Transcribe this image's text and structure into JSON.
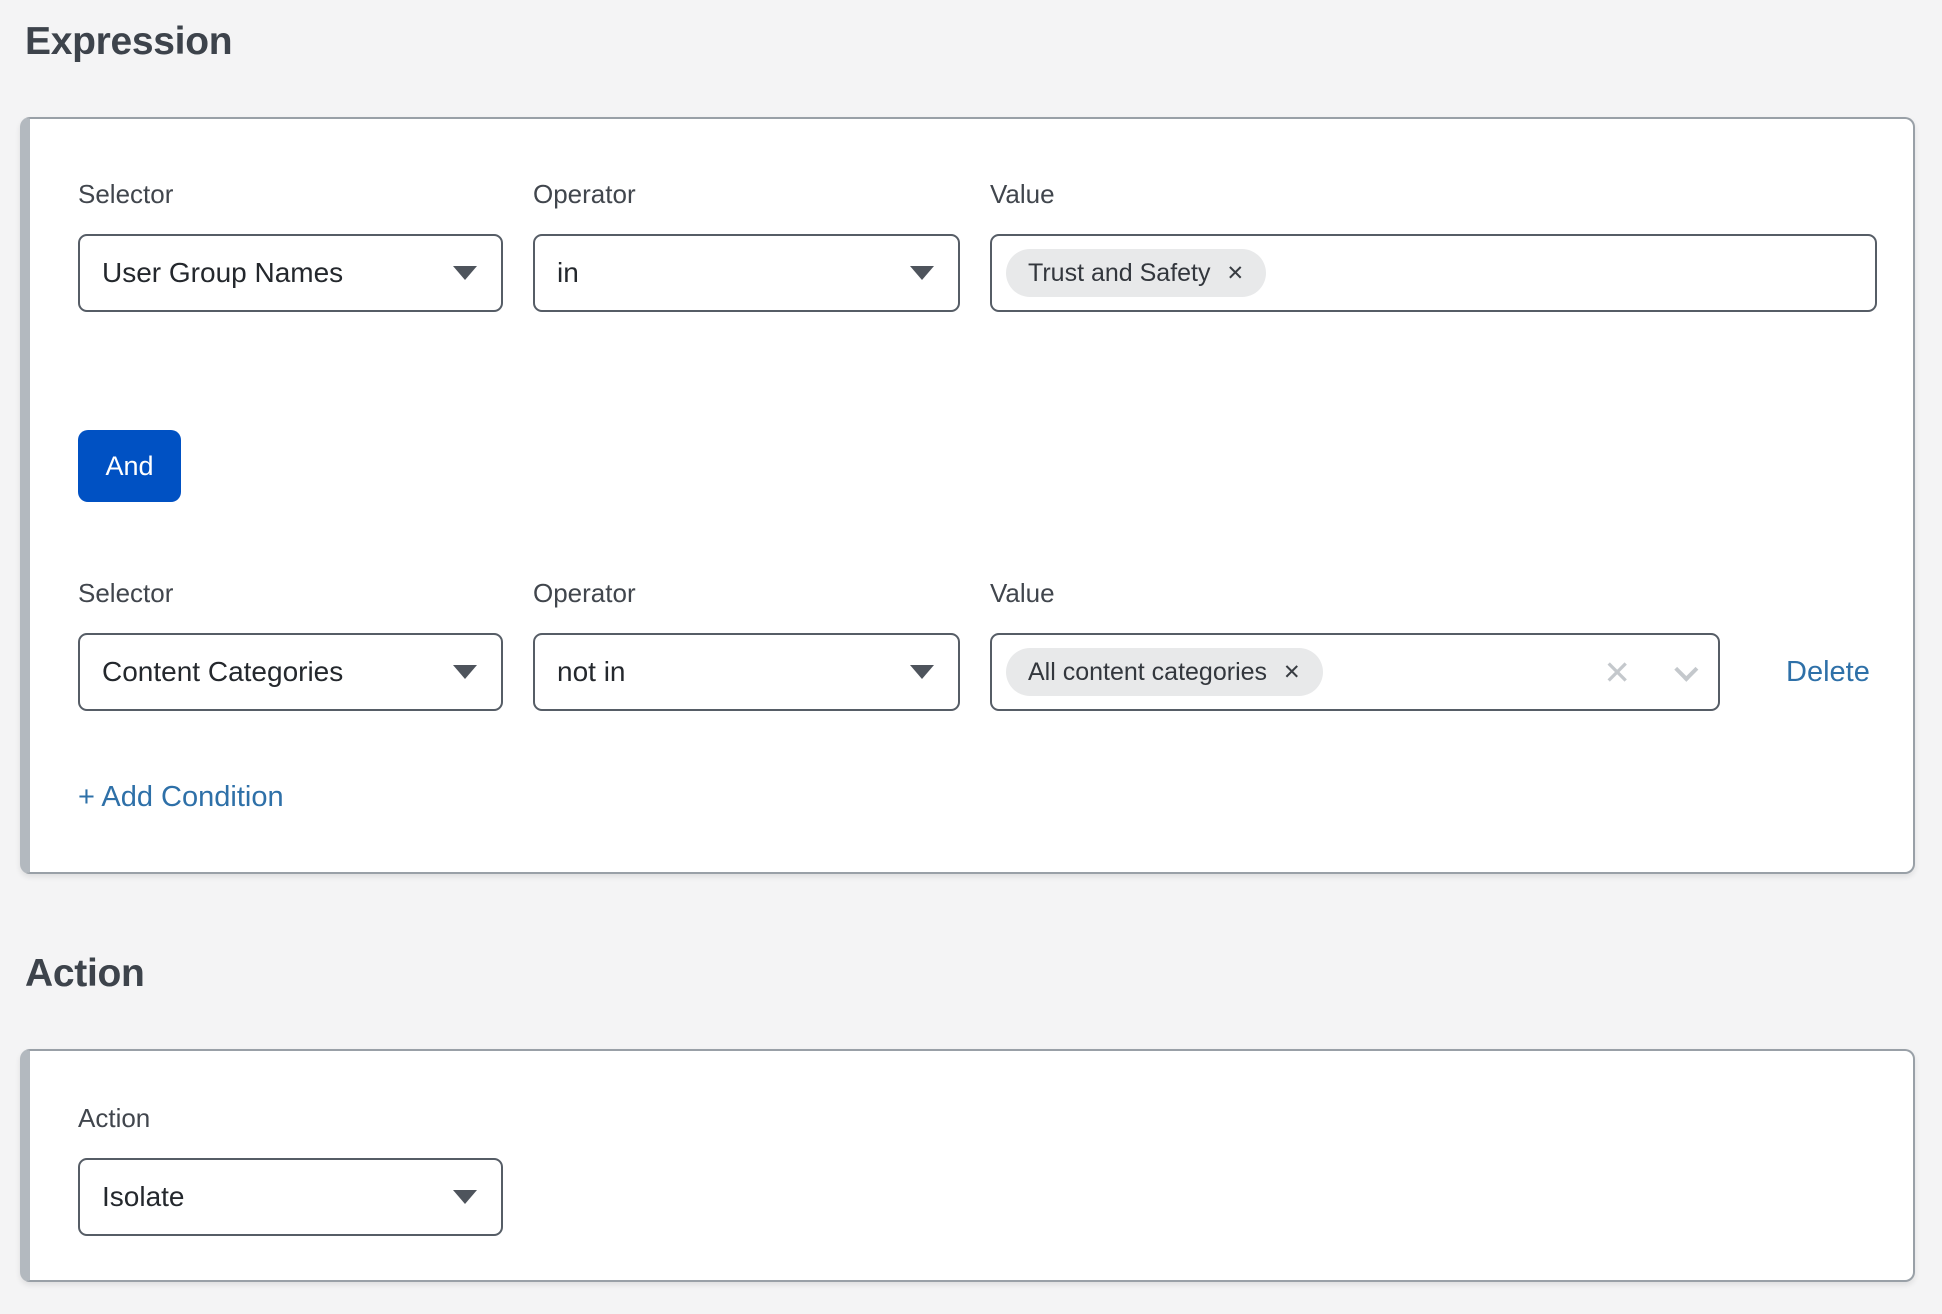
{
  "headings": {
    "expression": "Expression",
    "action": "Action"
  },
  "expression_card": {
    "and_button": "And",
    "add_condition": "+ Add Condition",
    "conditions": [
      {
        "labels": {
          "selector": "Selector",
          "operator": "Operator",
          "value": "Value"
        },
        "selector": "User Group Names",
        "operator": "in",
        "tags": [
          "Trust and Safety"
        ]
      },
      {
        "labels": {
          "selector": "Selector",
          "operator": "Operator",
          "value": "Value"
        },
        "selector": "Content Categories",
        "operator": "not in",
        "tags": [
          "All content categories"
        ],
        "delete_link": "Delete"
      }
    ]
  },
  "action_card": {
    "label": "Action",
    "value": "Isolate"
  },
  "icons": {
    "tag_remove": "✕",
    "clear": "✕"
  },
  "colors": {
    "primary_blue": "#0051c3",
    "link_blue": "#2e70a8",
    "page_bg": "#f4f4f5",
    "field_border": "#565d66",
    "card_border": "#99a0a7",
    "card_accent": "#b3b9bf",
    "tag_bg": "#e8e9ea"
  }
}
